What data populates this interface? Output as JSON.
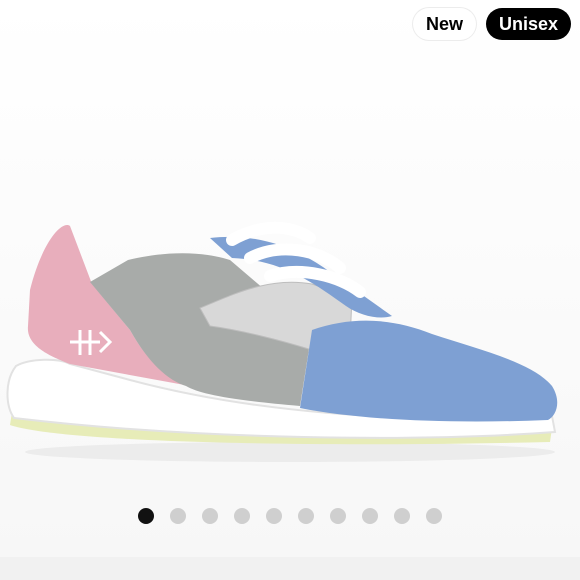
{
  "badges": {
    "new": "New",
    "unisex": "Unisex"
  },
  "carousel": {
    "total": 10,
    "active_index": 0
  },
  "product_image": {
    "subject": "sneaker-icon"
  },
  "colors": {
    "pink": "#e8aebc",
    "blue": "#7ea0d3",
    "grey": "#a8aba9",
    "mesh": "#d9d9d9",
    "sole": "#ffffff",
    "outsole": "#e6eab8"
  }
}
